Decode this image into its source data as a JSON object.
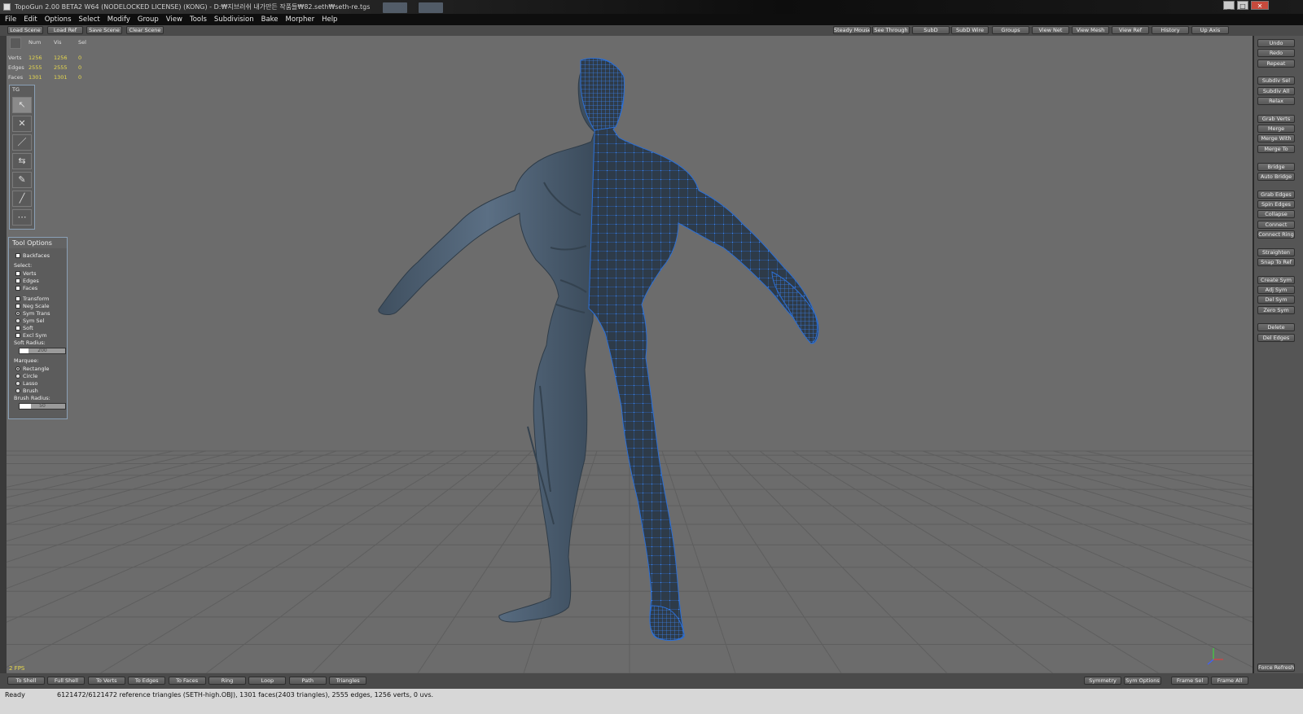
{
  "window": {
    "title": "TopoGun 2.00 BETA2 W64  (NODELOCKED LICENSE) (KONG) - D:₩지브러쉬 내가만든 작품들₩82.seth₩seth-re.tgs",
    "minimize_glyph": "_",
    "maximize_glyph": "□",
    "close_glyph": "✕"
  },
  "menu": [
    "File",
    "Edit",
    "Options",
    "Select",
    "Modify",
    "Group",
    "View",
    "Tools",
    "Subdivision",
    "Bake",
    "Morpher",
    "Help"
  ],
  "top_left_buttons": [
    "Load Scene",
    "Load Ref",
    "Save Scene",
    "Clear Scene"
  ],
  "top_right_buttons": [
    "Steady Mouse",
    "See Through",
    "SubD",
    "SubD Wire",
    "Groups",
    "View Net",
    "View Mesh",
    "View Ref",
    "History",
    "Up Axis"
  ],
  "stats": {
    "headers": [
      "Num",
      "Vis",
      "Sel"
    ],
    "rows": [
      {
        "label": "Verts",
        "num": "1256",
        "vis": "1256",
        "sel": "0"
      },
      {
        "label": "Edges",
        "num": "2555",
        "vis": "2555",
        "sel": "0"
      },
      {
        "label": "Faces",
        "num": "1301",
        "vis": "1301",
        "sel": "0"
      }
    ]
  },
  "tg_panel": {
    "title": "TG",
    "tools": [
      {
        "name": "select-tool-icon",
        "glyph": "↖"
      },
      {
        "name": "delete-tool-icon",
        "glyph": "✕"
      },
      {
        "name": "draw-tool-icon",
        "glyph": "／"
      },
      {
        "name": "bridge-tool-icon",
        "glyph": "⇆"
      },
      {
        "name": "brush-tool-icon",
        "glyph": "✎"
      },
      {
        "name": "edge-tool-icon",
        "glyph": "╱"
      },
      {
        "name": "grid-tool-icon",
        "glyph": "⋯"
      }
    ]
  },
  "tool_options": {
    "title": "Tool Options",
    "backfaces": "Backfaces",
    "select_label": "Select:",
    "select_items": [
      "Verts",
      "Edges",
      "Faces"
    ],
    "transform_items": [
      "Transform",
      "Neg Scale"
    ],
    "sym_trans": "Sym Trans",
    "sym_sel": "Sym Sel",
    "soft": "Soft",
    "excl_sym": "Excl Sym",
    "soft_radius_label": "Soft Radius:",
    "soft_radius_value": "200",
    "soft_radius_fraction": 0.2,
    "marquee_label": "Marquee:",
    "marquee_items": [
      "Rectangle",
      "Circle",
      "Lasso",
      "Brush"
    ],
    "marquee_selected": "Rectangle",
    "brush_radius_label": "Brush Radius:",
    "brush_radius_value": "50",
    "brush_radius_fraction": 0.25
  },
  "right_panel_groups": [
    [
      "Undo",
      "Redo",
      "Repeat"
    ],
    [
      "Subdiv Sel",
      "Subdiv All",
      "Relax"
    ],
    [
      "Grab Verts",
      "Merge",
      "Merge With",
      "Merge To"
    ],
    [
      "Bridge",
      "Auto Bridge"
    ],
    [
      "Grab Edges",
      "Spin Edges",
      "Collapse",
      "Connect",
      "Connect Ring"
    ],
    [
      "Straighten",
      "Snap To Ref"
    ],
    [
      "Create Sym",
      "Adj Sym",
      "Del Sym",
      "Zero Sym"
    ],
    [
      "Delete",
      "Del Edges"
    ]
  ],
  "force_refresh": "Force Refresh",
  "fps": "2 FPS",
  "bottom_left_buttons": [
    "To Shell",
    "Full Shell",
    "To Verts",
    "To Edges",
    "To Faces",
    "Ring",
    "Loop",
    "Path",
    "Triangles"
  ],
  "bottom_right_buttons": [
    "Symmetry",
    "Sym Options",
    "Frame Sel",
    "Frame All"
  ],
  "status": {
    "state": "Ready",
    "message": "6121472/6121472 reference triangles (SETH-high.OBJ), 1301 faces(2403 triangles), 2555 edges, 1256 verts, 0 uvs."
  },
  "colors": {
    "viewport_bg": "#6c6c6c",
    "model": "#4f6275",
    "wire": "#2b6fd6",
    "stats_value": "#e8d94d"
  }
}
